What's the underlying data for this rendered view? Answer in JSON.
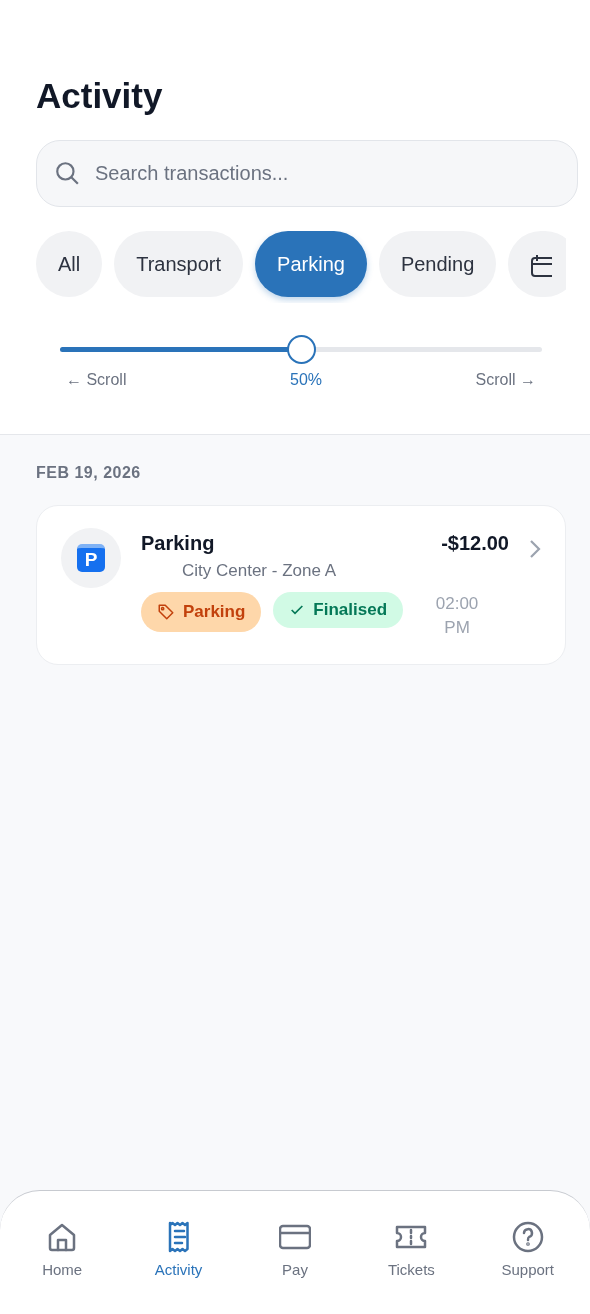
{
  "title": "Activity",
  "search": {
    "placeholder": "Search transactions..."
  },
  "chips": [
    {
      "kind": "text",
      "label": "All",
      "selected": false
    },
    {
      "kind": "text",
      "label": "Transport",
      "selected": false
    },
    {
      "kind": "text",
      "label": "Parking",
      "selected": true
    },
    {
      "kind": "text",
      "label": "Pending",
      "selected": false
    },
    {
      "kind": "calendar",
      "selected": false
    }
  ],
  "scroller": {
    "left_label": "← Scroll",
    "reading": "50%",
    "right_label": "Scroll →"
  },
  "groups": [
    {
      "date": "FEB 19, 2026",
      "transactions": [
        {
          "icon_letter": "P",
          "title": "Parking",
          "subtitle": "City Center - Zone A",
          "amount": "-$12.00",
          "category": "Parking",
          "status": "Finalised",
          "time": "02:00 PM"
        }
      ]
    }
  ],
  "nav": [
    {
      "label": "Home",
      "kind": "home",
      "selected": false
    },
    {
      "label": "Activity",
      "kind": "receipt",
      "selected": true
    },
    {
      "label": "Pay",
      "kind": "card",
      "selected": false
    },
    {
      "label": "Tickets",
      "kind": "ticket",
      "selected": false
    },
    {
      "label": "Support",
      "kind": "help",
      "selected": false
    }
  ]
}
